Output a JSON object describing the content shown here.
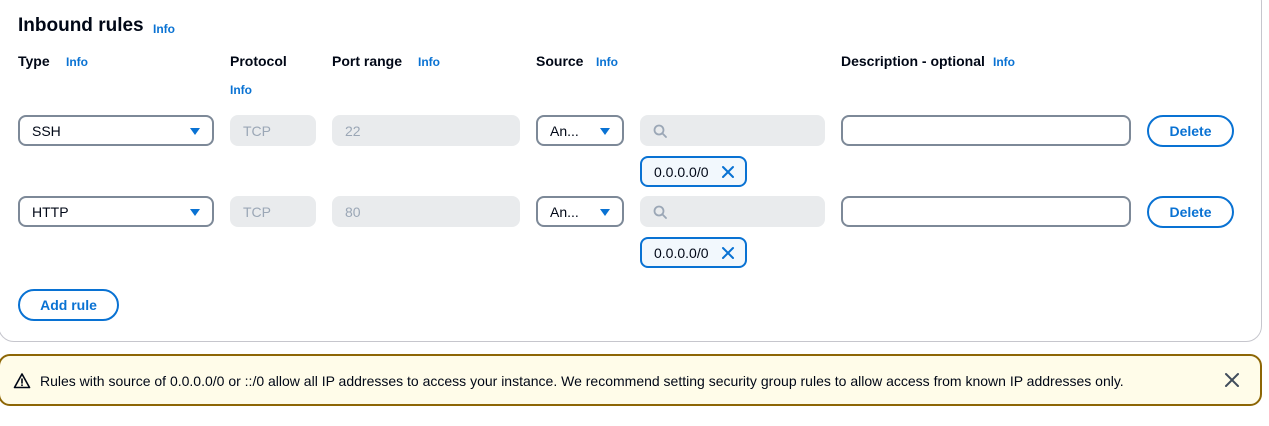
{
  "section": {
    "title": "Inbound rules",
    "title_info": "Info"
  },
  "columns": {
    "type": "Type",
    "type_info": "Info",
    "protocol": "Protocol",
    "protocol_info": "Info",
    "port_range": "Port range",
    "port_range_info": "Info",
    "source": "Source",
    "source_info": "Info",
    "description": "Description - optional",
    "description_info": "Info"
  },
  "rules": [
    {
      "type": "SSH",
      "protocol": "TCP",
      "port_range": "22",
      "source": "An...",
      "search_value": "",
      "cidr": "0.0.0.0/0",
      "description": "",
      "delete_label": "Delete"
    },
    {
      "type": "HTTP",
      "protocol": "TCP",
      "port_range": "80",
      "source": "An...",
      "search_value": "",
      "cidr": "0.0.0.0/0",
      "description": "",
      "delete_label": "Delete"
    }
  ],
  "add_rule_label": "Add rule",
  "alert": {
    "message": "Rules with source of 0.0.0.0/0 or ::/0 allow all IP addresses to access your instance. We recommend setting security group rules to allow access from known IP addresses only."
  },
  "colors": {
    "link": "#0972d3",
    "warning_border": "#8d6605",
    "warning_bg": "#fffce9"
  },
  "icons": {
    "select_caret": "caret-down-icon",
    "search": "search-icon",
    "token_remove": "close-icon",
    "warning": "warning-icon",
    "dismiss": "close-icon"
  }
}
